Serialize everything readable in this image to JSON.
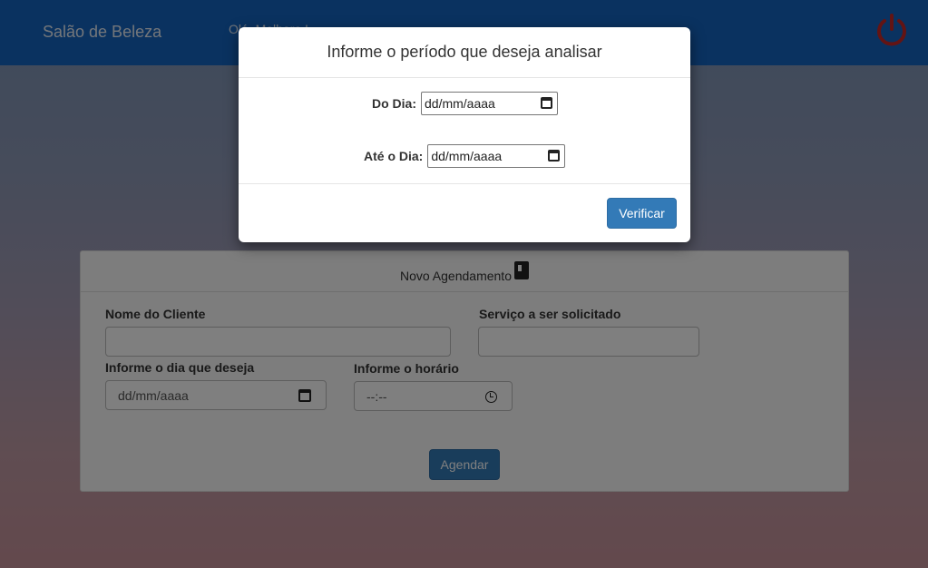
{
  "navbar": {
    "brand": "Salão de Beleza",
    "greeting": "Olá, Melhore !",
    "power_icon": "power-icon",
    "accent_color": "#1565c0"
  },
  "panel": {
    "title": "Novo Agendamento",
    "title_icon": "book-icon",
    "client_name_label": "Nome do Cliente",
    "client_name_value": "",
    "service_label": "Serviço a ser solicitado",
    "service_value": "",
    "date_label": "Informe o dia que deseja",
    "date_placeholder": "dd/mm/aaaa",
    "time_label": "Informe o horário",
    "time_placeholder": "--:--",
    "submit_label": "Agendar"
  },
  "modal": {
    "title": "Informe o período que deseja analisar",
    "from_label": "Do Dia:",
    "from_placeholder": "dd/mm/aaaa",
    "to_label": "Até o Dia:",
    "to_placeholder": "dd/mm/aaaa",
    "submit_label": "Verificar",
    "button_color": "#337ab7"
  }
}
